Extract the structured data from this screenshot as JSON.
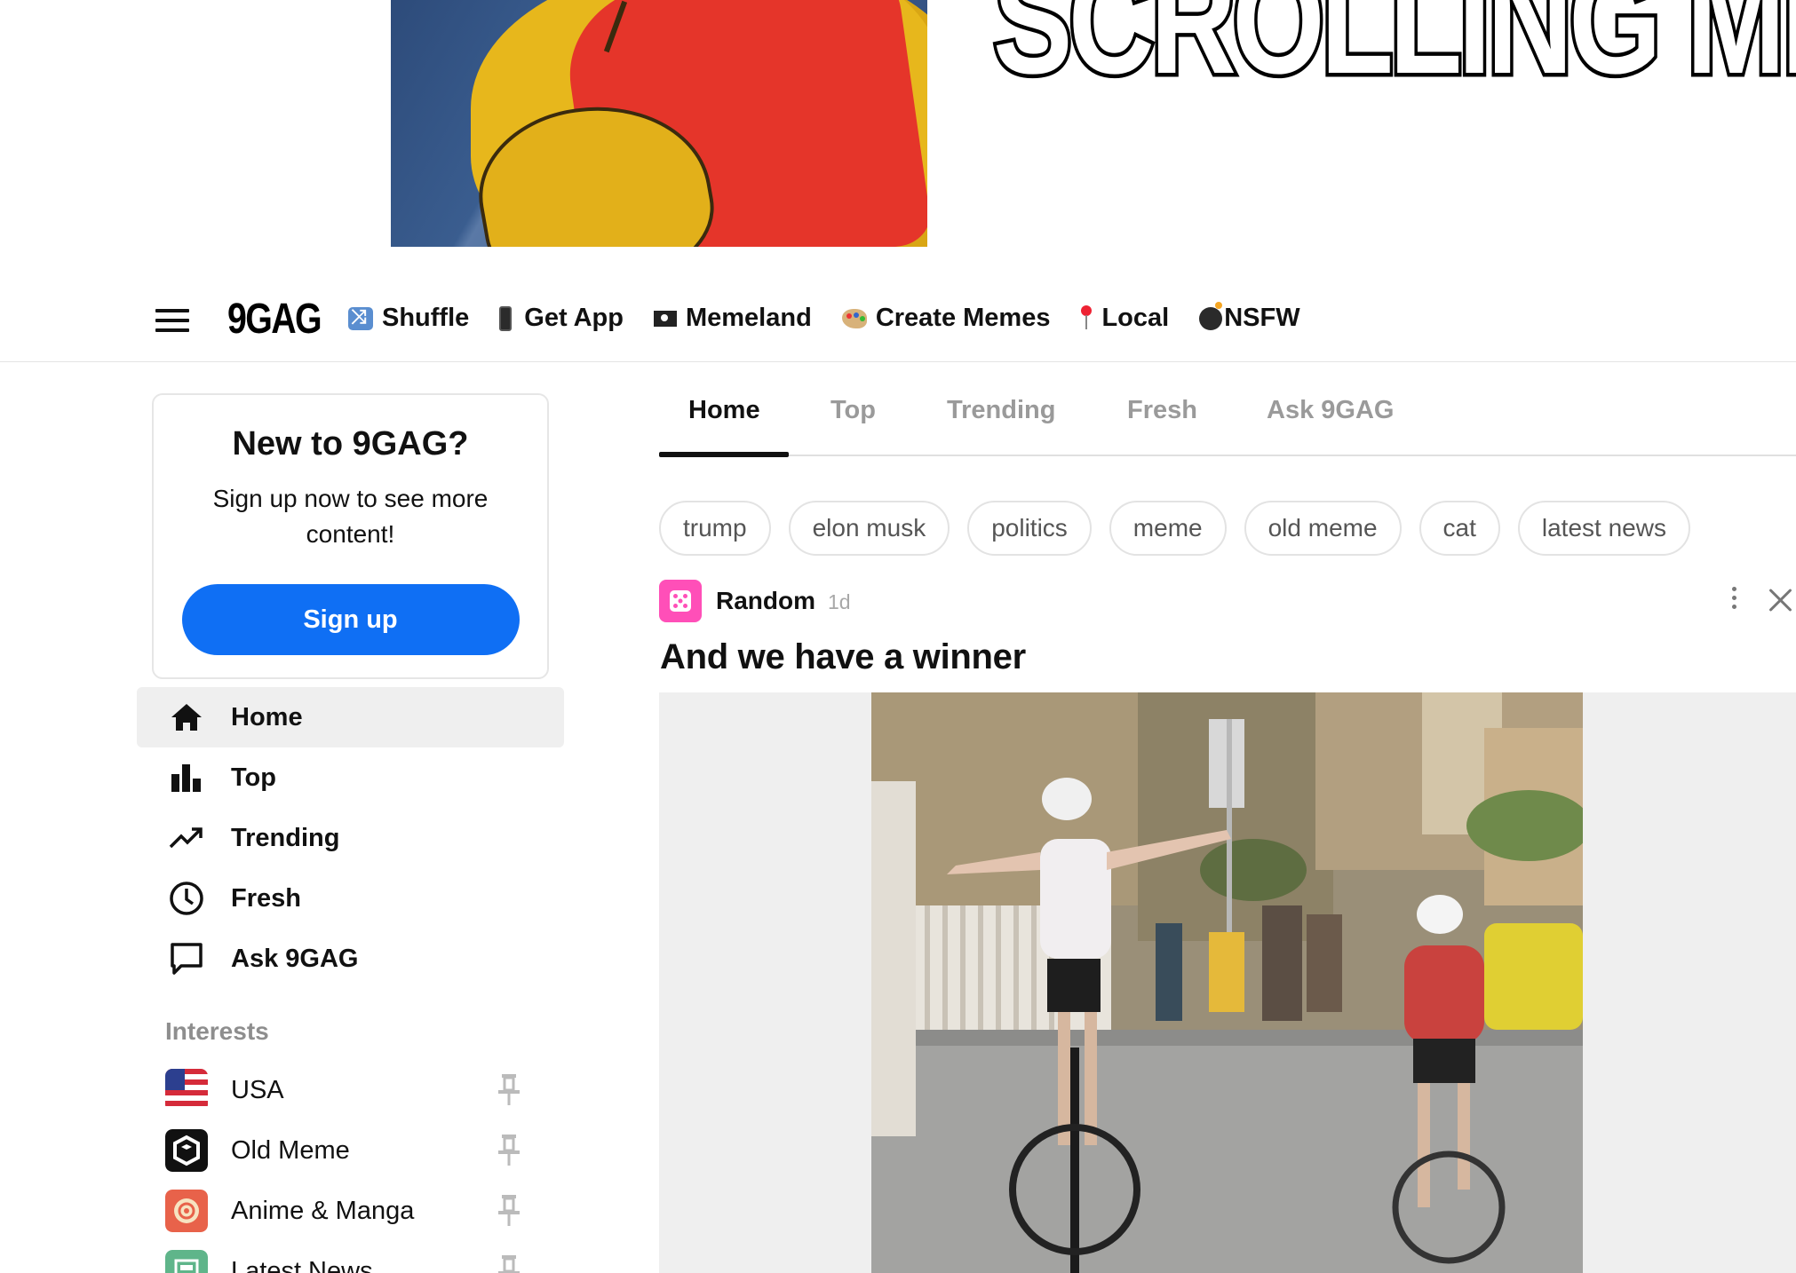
{
  "banner": {
    "text": "SCROLLING ME"
  },
  "topnav": {
    "logo": "9GAG",
    "links": [
      {
        "label": "Shuffle",
        "icon": "shuffle-icon"
      },
      {
        "label": "Get App",
        "icon": "phone-icon"
      },
      {
        "label": "Memeland",
        "icon": "pirate-flag-icon"
      },
      {
        "label": "Create Memes",
        "icon": "palette-icon"
      },
      {
        "label": "Local",
        "icon": "pin-icon"
      },
      {
        "label": "NSFW",
        "icon": "bomb-icon"
      }
    ]
  },
  "signup": {
    "title": "New to 9GAG?",
    "subtitle": "Sign up now to see more content!",
    "button": "Sign up"
  },
  "sidebar": {
    "items": [
      {
        "label": "Home",
        "icon": "home-icon",
        "active": true
      },
      {
        "label": "Top",
        "icon": "bar-chart-icon"
      },
      {
        "label": "Trending",
        "icon": "trending-icon"
      },
      {
        "label": "Fresh",
        "icon": "clock-icon"
      },
      {
        "label": "Ask 9GAG",
        "icon": "chat-bubble-icon"
      }
    ],
    "interests_title": "Interests",
    "interests": [
      {
        "label": "USA",
        "icon": "usa-flag-icon"
      },
      {
        "label": "Old Meme",
        "icon": "old-meme-icon"
      },
      {
        "label": "Anime & Manga",
        "icon": "anime-icon"
      },
      {
        "label": "Latest News",
        "icon": "news-icon"
      }
    ]
  },
  "tabs": [
    {
      "label": "Home",
      "active": true
    },
    {
      "label": "Top"
    },
    {
      "label": "Trending"
    },
    {
      "label": "Fresh"
    },
    {
      "label": "Ask 9GAG"
    }
  ],
  "chips": [
    "trump",
    "elon musk",
    "politics",
    "meme",
    "old meme",
    "cat",
    "latest news"
  ],
  "post": {
    "group": "Random",
    "time": "1d",
    "title": "And we have a winner"
  },
  "colors": {
    "accent": "#0f6ff4",
    "group_icon": "#ff4fb8"
  }
}
